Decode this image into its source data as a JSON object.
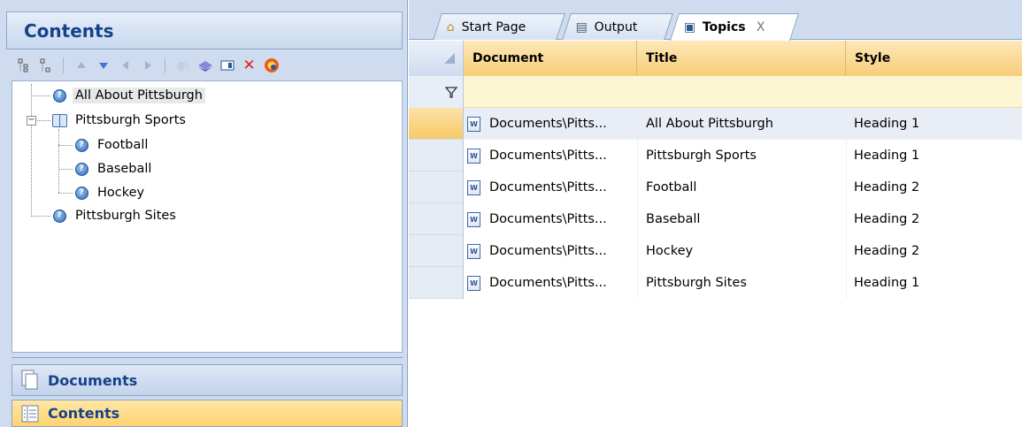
{
  "left_panel": {
    "title": "Contents",
    "tree": [
      {
        "label": "All About Pittsburgh",
        "icon": "help-topic-icon",
        "selected": true
      },
      {
        "label": "Pittsburgh Sports",
        "icon": "book-open-icon"
      },
      {
        "label": "Football",
        "icon": "help-topic-icon"
      },
      {
        "label": "Baseball",
        "icon": "help-topic-icon"
      },
      {
        "label": "Hockey",
        "icon": "help-topic-icon"
      },
      {
        "label": "Pittsburgh Sites",
        "icon": "help-topic-icon"
      }
    ],
    "expander_symbol": "−",
    "nav": {
      "documents_label": "Documents",
      "contents_label": "Contents"
    }
  },
  "tabs": [
    {
      "label": "Start Page",
      "icon": "home-icon"
    },
    {
      "label": "Output",
      "icon": "output-list-icon"
    },
    {
      "label": "Topics",
      "icon": "topic-doc-icon",
      "active": true,
      "close_symbol": "X"
    }
  ],
  "grid": {
    "columns": [
      "Document",
      "Title",
      "Style"
    ],
    "rows": [
      {
        "document": "Documents\\Pitts...",
        "title": "All About Pittsburgh",
        "style": "Heading 1"
      },
      {
        "document": "Documents\\Pitts...",
        "title": "Pittsburgh Sports",
        "style": "Heading 1"
      },
      {
        "document": "Documents\\Pitts...",
        "title": "Football",
        "style": "Heading 2"
      },
      {
        "document": "Documents\\Pitts...",
        "title": "Baseball",
        "style": "Heading 2"
      },
      {
        "document": "Documents\\Pitts...",
        "title": "Hockey",
        "style": "Heading 2"
      },
      {
        "document": "Documents\\Pitts...",
        "title": "Pittsburgh Sites",
        "style": "Heading 1"
      }
    ]
  },
  "colors": {
    "accent_blue": "#15428b",
    "header_orange": "#f8cd7a",
    "filter_row": "#fdf6d2",
    "delete_red": "#e0201b"
  }
}
